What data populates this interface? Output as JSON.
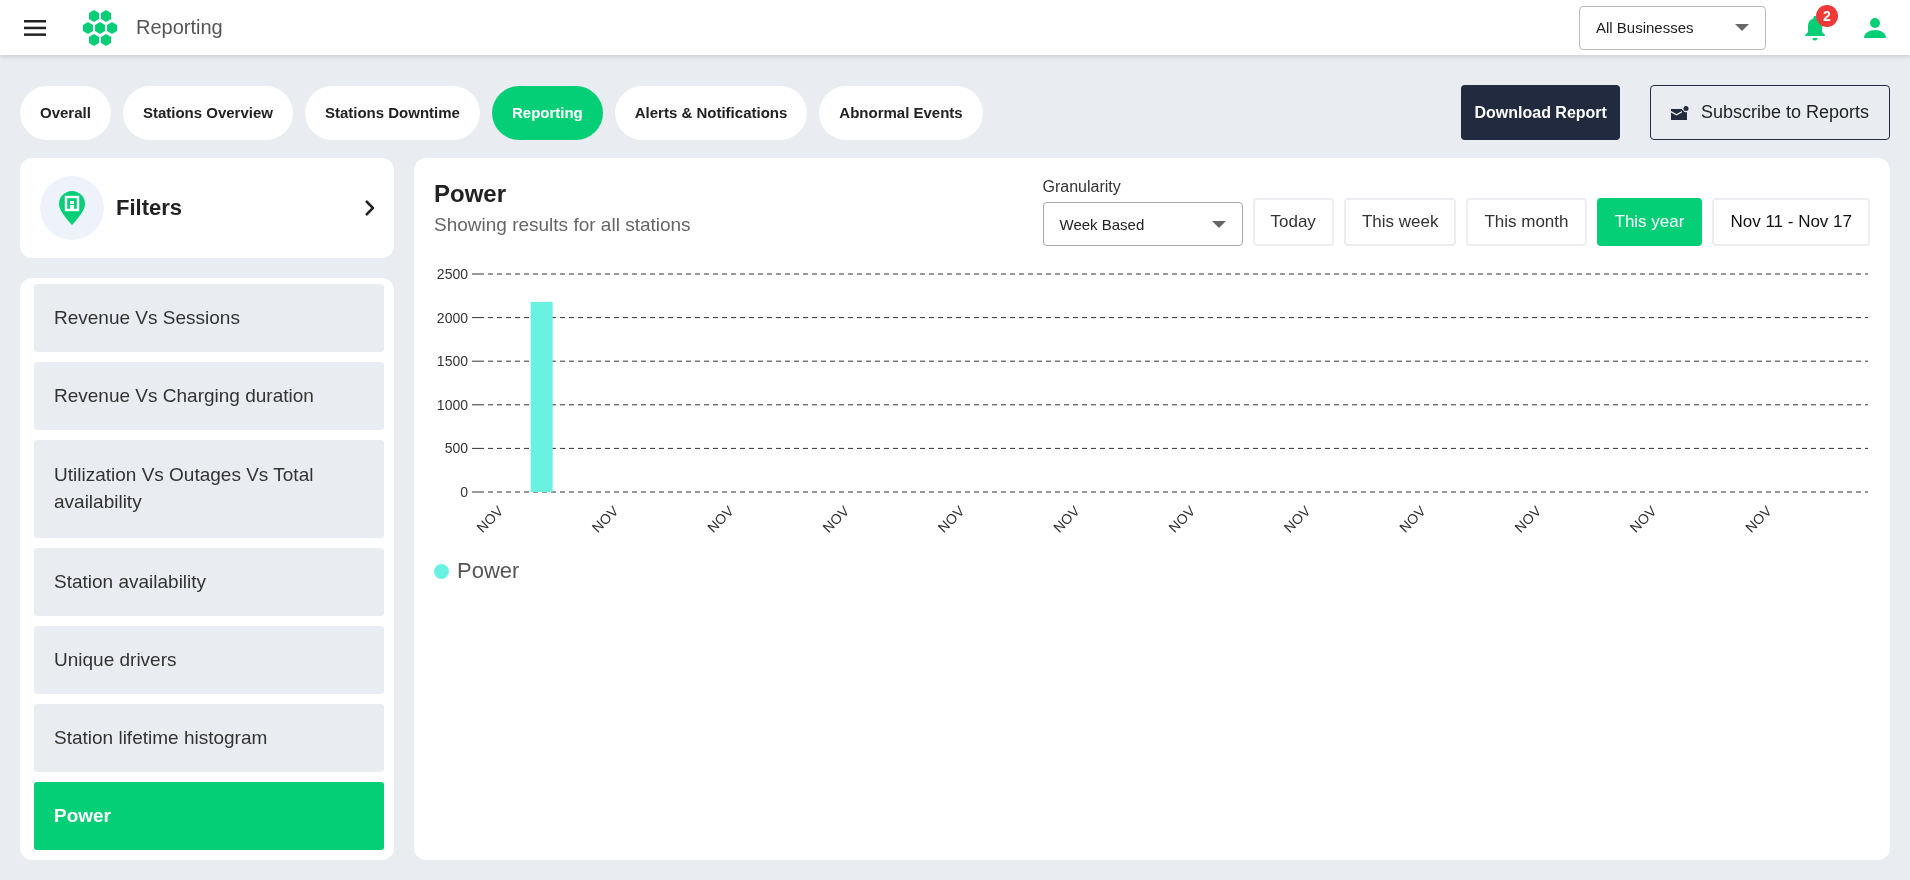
{
  "header": {
    "title": "Reporting",
    "business_select": {
      "value": "All Businesses"
    },
    "notifications": {
      "count": "2"
    }
  },
  "tabs": [
    {
      "label": "Overall",
      "selected": false
    },
    {
      "label": "Stations Overview",
      "selected": false
    },
    {
      "label": "Stations Downtime",
      "selected": false
    },
    {
      "label": "Reporting",
      "selected": true
    },
    {
      "label": "Alerts & Notifications",
      "selected": false
    },
    {
      "label": "Abnormal Events",
      "selected": false
    }
  ],
  "actions": {
    "download": "Download Report",
    "subscribe": "Subscribe to Reports"
  },
  "filters": {
    "title": "Filters"
  },
  "reports": [
    {
      "label": "Revenue Vs Sessions",
      "selected": false
    },
    {
      "label": "Revenue Vs Charging duration",
      "selected": false
    },
    {
      "label": "Utilization Vs Outages Vs Total availability",
      "selected": false
    },
    {
      "label": "Station availability",
      "selected": false
    },
    {
      "label": "Unique drivers",
      "selected": false
    },
    {
      "label": "Station lifetime histogram",
      "selected": false
    },
    {
      "label": "Power",
      "selected": true
    }
  ],
  "panel": {
    "title": "Power",
    "subtitle": "Showing results for all stations",
    "granularity": {
      "label": "Granularity",
      "value": "Week Based"
    },
    "ranges": [
      {
        "label": "Today",
        "selected": false
      },
      {
        "label": "This week",
        "selected": false
      },
      {
        "label": "This month",
        "selected": false
      },
      {
        "label": "This year",
        "selected": true
      }
    ],
    "date_range": "Nov 11 - Nov 17",
    "chart_data": {
      "type": "bar",
      "categories": [
        "NOV",
        "NOV",
        "NOV",
        "NOV",
        "NOV",
        "NOV",
        "NOV",
        "NOV",
        "NOV",
        "NOV",
        "NOV",
        "NOV"
      ],
      "series": [
        {
          "name": "Power",
          "color": "#6af2e0",
          "values": [
            2180,
            0,
            0,
            0,
            0,
            0,
            0,
            0,
            0,
            0,
            0,
            0
          ]
        }
      ],
      "grid": true,
      "ylim": [
        0,
        2500
      ],
      "yticks": [
        0,
        500,
        1000,
        1500,
        2000,
        2500
      ]
    }
  }
}
